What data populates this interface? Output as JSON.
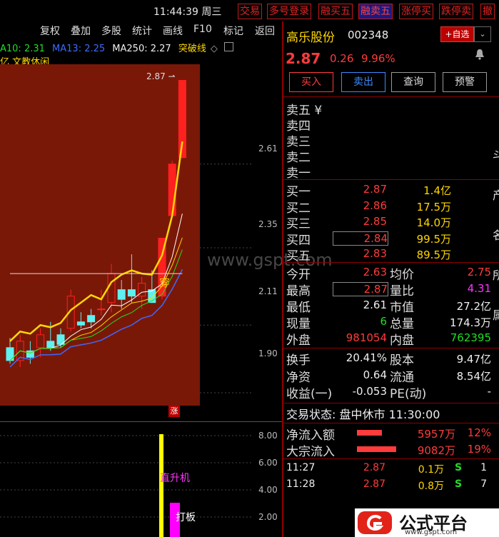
{
  "top": {
    "time": "11:44:39",
    "weekday": "周三",
    "buttons": [
      "交易",
      "多号登录",
      "融买五",
      "融卖五",
      "涨停买",
      "跌停卖",
      "撤"
    ]
  },
  "chart_toolbar": [
    "复权",
    "叠加",
    "多股",
    "统计",
    "画线",
    "F10",
    "标记",
    "返回"
  ],
  "ma_legend": {
    "ma10": "A10: 2.31",
    "ma13": "MA13: 2.25",
    "ma250": "MA250: 2.27",
    "breakout": "突破线",
    "colors": {
      "ma10": "#22dd22",
      "ma13": "#3b6bff",
      "ma250": "#eeeeee",
      "breakout": "#ffd700"
    }
  },
  "sub_legend": "亿 文教休闲",
  "price_axis": [
    "2.61",
    "2.35",
    "2.11",
    "1.90"
  ],
  "sub_axis": [
    "8.00",
    "6.00",
    "4.00",
    "2.00"
  ],
  "chart_annotations": {
    "high_label": "2.87",
    "chuan": "穿",
    "zhang": "涨",
    "zhishengji": "直升机",
    "daban": "打板"
  },
  "watermark": "www.gspt.com",
  "chart_data": {
    "type": "candlestick",
    "title": "",
    "ohlc": [
      {
        "o": 2.04,
        "h": 2.07,
        "l": 1.99,
        "c": 2.0
      },
      {
        "o": 2.0,
        "h": 2.08,
        "l": 1.98,
        "c": 2.06
      },
      {
        "o": 2.03,
        "h": 2.06,
        "l": 1.99,
        "c": 2.01
      },
      {
        "o": 2.04,
        "h": 2.1,
        "l": 2.01,
        "c": 2.08
      },
      {
        "o": 2.06,
        "h": 2.12,
        "l": 2.03,
        "c": 2.04
      },
      {
        "o": 2.08,
        "h": 2.1,
        "l": 2.04,
        "c": 2.05
      },
      {
        "o": 2.1,
        "h": 2.22,
        "l": 2.09,
        "c": 2.2
      },
      {
        "o": 2.12,
        "h": 2.15,
        "l": 2.1,
        "c": 2.11
      },
      {
        "o": 2.14,
        "h": 2.16,
        "l": 2.1,
        "c": 2.12
      },
      {
        "o": 2.16,
        "h": 2.22,
        "l": 2.14,
        "c": 2.16
      },
      {
        "o": 2.18,
        "h": 2.3,
        "l": 2.15,
        "c": 2.27
      },
      {
        "o": 2.22,
        "h": 2.25,
        "l": 2.16,
        "c": 2.19
      },
      {
        "o": 2.22,
        "h": 2.33,
        "l": 2.18,
        "c": 2.2
      },
      {
        "o": 2.2,
        "h": 2.26,
        "l": 2.16,
        "c": 2.24
      },
      {
        "o": 2.22,
        "h": 2.28,
        "l": 2.19,
        "c": 2.18
      },
      {
        "o": 2.2,
        "h": 2.38,
        "l": 2.19,
        "c": 2.38
      },
      {
        "o": 2.45,
        "h": 2.62,
        "l": 2.45,
        "c": 2.61
      },
      {
        "o": 2.63,
        "h": 2.87,
        "l": 2.63,
        "c": 2.87
      }
    ],
    "ylim": [
      1.86,
      2.92
    ]
  },
  "stock": {
    "name": "高乐股份",
    "code": "002348",
    "add_fav": "+自选",
    "price": "2.87",
    "change": "0.26",
    "change_pct": "9.96%",
    "actions": [
      "买入",
      "卖出",
      "查询",
      "预警"
    ]
  },
  "sell_book": [
    "卖五 ¥",
    "卖四",
    "卖三",
    "卖二",
    "卖一"
  ],
  "buy_book": [
    {
      "label": "买一",
      "price": "2.87",
      "vol": "1.4亿"
    },
    {
      "label": "买二",
      "price": "2.86",
      "vol": "17.5万"
    },
    {
      "label": "买三",
      "price": "2.85",
      "vol": "14.0万"
    },
    {
      "label": "买四",
      "price": "2.84",
      "vol": "99.5万"
    },
    {
      "label": "买五",
      "price": "2.83",
      "vol": "89.5万"
    }
  ],
  "stats": [
    {
      "l1": "今开",
      "v1": "2.63",
      "l2": "均价",
      "v2": "2.75",
      "c1": "red",
      "c2": "red"
    },
    {
      "l1": "最高",
      "v1": "2.87",
      "l2": "量比",
      "v2": "4.31",
      "c1": "red",
      "c2": "mag"
    },
    {
      "l1": "最低",
      "v1": "2.61",
      "l2": "市值",
      "v2": "27.2亿",
      "c1": "wht",
      "c2": "wht"
    },
    {
      "l1": "现量",
      "v1": "6",
      "l2": "总量",
      "v2": "174.3万",
      "c1": "grn",
      "c2": "wht"
    },
    {
      "l1": "外盘",
      "v1": "981054",
      "l2": "内盘",
      "v2": "762395",
      "c1": "red",
      "c2": "grn"
    }
  ],
  "stats2": [
    {
      "l1": "换手",
      "v1": "20.41%",
      "l2": "股本",
      "v2": "9.47亿"
    },
    {
      "l1": "净资",
      "v1": "0.64",
      "l2": "流通",
      "v2": "8.54亿"
    },
    {
      "l1": "收益(一)",
      "v1": "-0.053",
      "l2": "PE(动)",
      "v2": "-"
    }
  ],
  "status": "交易状态: 盘中休市 11:30:00",
  "flows": [
    {
      "label": "净流入额",
      "value": "5957万",
      "pct": "12%",
      "bar": 0.12
    },
    {
      "label": "大宗流入",
      "value": "9082万",
      "pct": "19%",
      "bar": 0.19
    }
  ],
  "ticks": [
    {
      "time": "11:27",
      "price": "2.87",
      "vol": "0.1万",
      "side": "S",
      "n": "1"
    },
    {
      "time": "11:28",
      "price": "2.87",
      "vol": "0.8万",
      "side": "S",
      "n": "7"
    }
  ],
  "logo": {
    "text": "公式平台",
    "url": "www.gspt.com"
  },
  "right_edge_chars": [
    "斗",
    "产",
    "名",
    "所",
    "属"
  ]
}
